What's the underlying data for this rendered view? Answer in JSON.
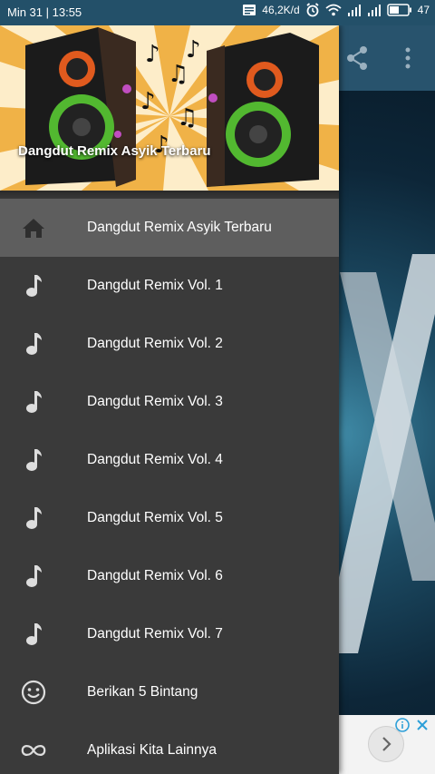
{
  "status_bar": {
    "time": "Min 31 | 13:55",
    "network_speed": "46,2K/d",
    "battery": "47"
  },
  "drawer": {
    "header_title": "Dangdut Remix Asyik Terbaru",
    "items": [
      {
        "label": "Dangdut Remix Asyik Terbaru",
        "icon": "home-icon",
        "active": true
      },
      {
        "label": "Dangdut Remix Vol. 1",
        "icon": "music-note-icon"
      },
      {
        "label": "Dangdut Remix Vol. 2",
        "icon": "music-note-icon"
      },
      {
        "label": "Dangdut Remix Vol. 3",
        "icon": "music-note-icon"
      },
      {
        "label": "Dangdut Remix Vol. 4",
        "icon": "music-note-icon"
      },
      {
        "label": "Dangdut Remix Vol. 5",
        "icon": "music-note-icon"
      },
      {
        "label": "Dangdut Remix Vol. 6",
        "icon": "music-note-icon"
      },
      {
        "label": "Dangdut Remix Vol. 7",
        "icon": "music-note-icon"
      },
      {
        "label": "Berikan 5 Bintang",
        "icon": "smiley-icon"
      },
      {
        "label": "Aplikasi Kita Lainnya",
        "icon": "infinity-icon"
      }
    ]
  },
  "colors": {
    "status_bar": "#235069",
    "toolbar": "#28536d",
    "drawer_bg": "#3a3a3a",
    "active_item_bg": "#5e5e5e",
    "ad_close_accent": "#2d9fd8"
  }
}
